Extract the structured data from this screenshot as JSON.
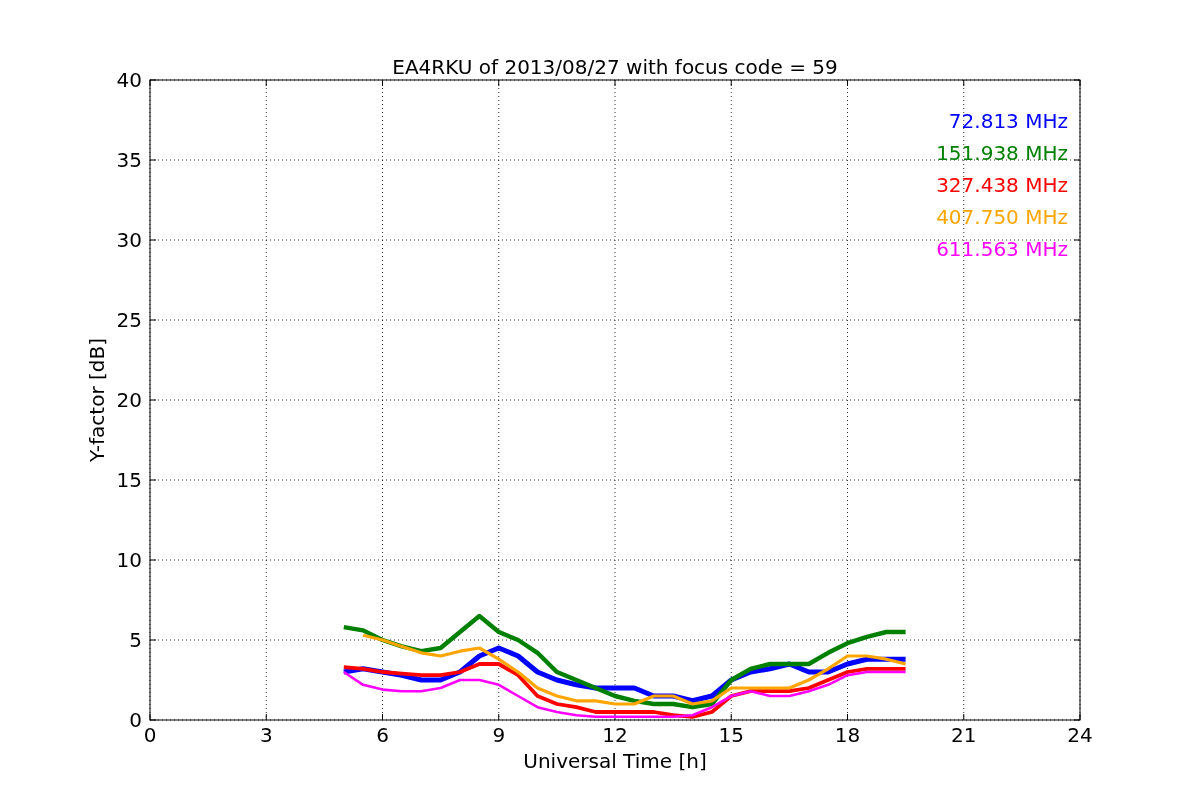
{
  "chart_data": {
    "type": "line",
    "title": "EA4RKU of 2013/08/27 with focus code = 59",
    "xlabel": "Universal Time [h]",
    "ylabel": "Y-factor [dB]",
    "x": [
      5,
      5.5,
      6,
      6.5,
      7,
      7.5,
      8,
      8.5,
      9,
      9.5,
      10,
      10.5,
      11,
      11.5,
      12,
      12.5,
      13,
      13.5,
      14,
      14.5,
      15,
      15.5,
      16,
      16.5,
      17,
      17.5,
      18,
      18.5,
      19,
      19.5
    ],
    "series": [
      {
        "name": "72.813 MHz",
        "color": "#0000ff",
        "values": [
          3,
          3.2,
          3,
          2.8,
          2.5,
          2.5,
          3,
          4,
          4.5,
          4,
          3,
          2.5,
          2.2,
          2,
          2,
          2,
          1.5,
          1.5,
          1.2,
          1.5,
          2.5,
          3,
          3.2,
          3.5,
          3,
          3,
          3.5,
          3.8,
          3.8,
          3.8
        ]
      },
      {
        "name": "151.938 MHz",
        "color": "#008000",
        "values": [
          5.8,
          5.6,
          5,
          4.6,
          4.3,
          4.5,
          5.5,
          6.5,
          5.5,
          5,
          4.2,
          3,
          2.5,
          2,
          1.5,
          1.2,
          1,
          1,
          0.8,
          1,
          2.5,
          3.2,
          3.5,
          3.5,
          3.5,
          4.2,
          4.8,
          5.2,
          5.5,
          5.5
        ]
      },
      {
        "name": "327.438 MHz",
        "color": "#ff0000",
        "values": [
          3.3,
          3.2,
          3,
          2.9,
          2.8,
          2.8,
          3,
          3.5,
          3.5,
          2.8,
          1.5,
          1,
          0.8,
          0.5,
          0.5,
          0.5,
          0.5,
          0.3,
          0.2,
          0.5,
          1.5,
          1.8,
          1.8,
          1.8,
          2,
          2.5,
          3,
          3.2,
          3.2,
          3.2
        ]
      },
      {
        "name": "407.750 MHz",
        "color": "#ffa500",
        "values": [
          null,
          5.3,
          5,
          4.6,
          4.2,
          4,
          4.3,
          4.5,
          3.8,
          3,
          2,
          1.5,
          1.2,
          1.2,
          1,
          1,
          1.5,
          1.5,
          1,
          1.2,
          2,
          2,
          2,
          2,
          2.5,
          3.2,
          4,
          4,
          3.8,
          3.5
        ]
      },
      {
        "name": "611.563 MHz",
        "color": "#ff00ff",
        "values": [
          3,
          2.2,
          1.9,
          1.8,
          1.8,
          2,
          2.5,
          2.5,
          2.2,
          1.5,
          0.8,
          0.5,
          0.3,
          0.2,
          0.2,
          0.2,
          0.2,
          0.2,
          0.3,
          0.8,
          1.5,
          1.8,
          1.5,
          1.5,
          1.8,
          2.2,
          2.8,
          3,
          3,
          3
        ]
      }
    ],
    "grid": true,
    "xlim": [
      0,
      24
    ],
    "ylim": [
      0,
      40
    ],
    "xticks": [
      0,
      3,
      6,
      9,
      12,
      15,
      18,
      21,
      24
    ],
    "yticks": [
      0,
      5,
      10,
      15,
      20,
      25,
      30,
      35,
      40
    ]
  }
}
